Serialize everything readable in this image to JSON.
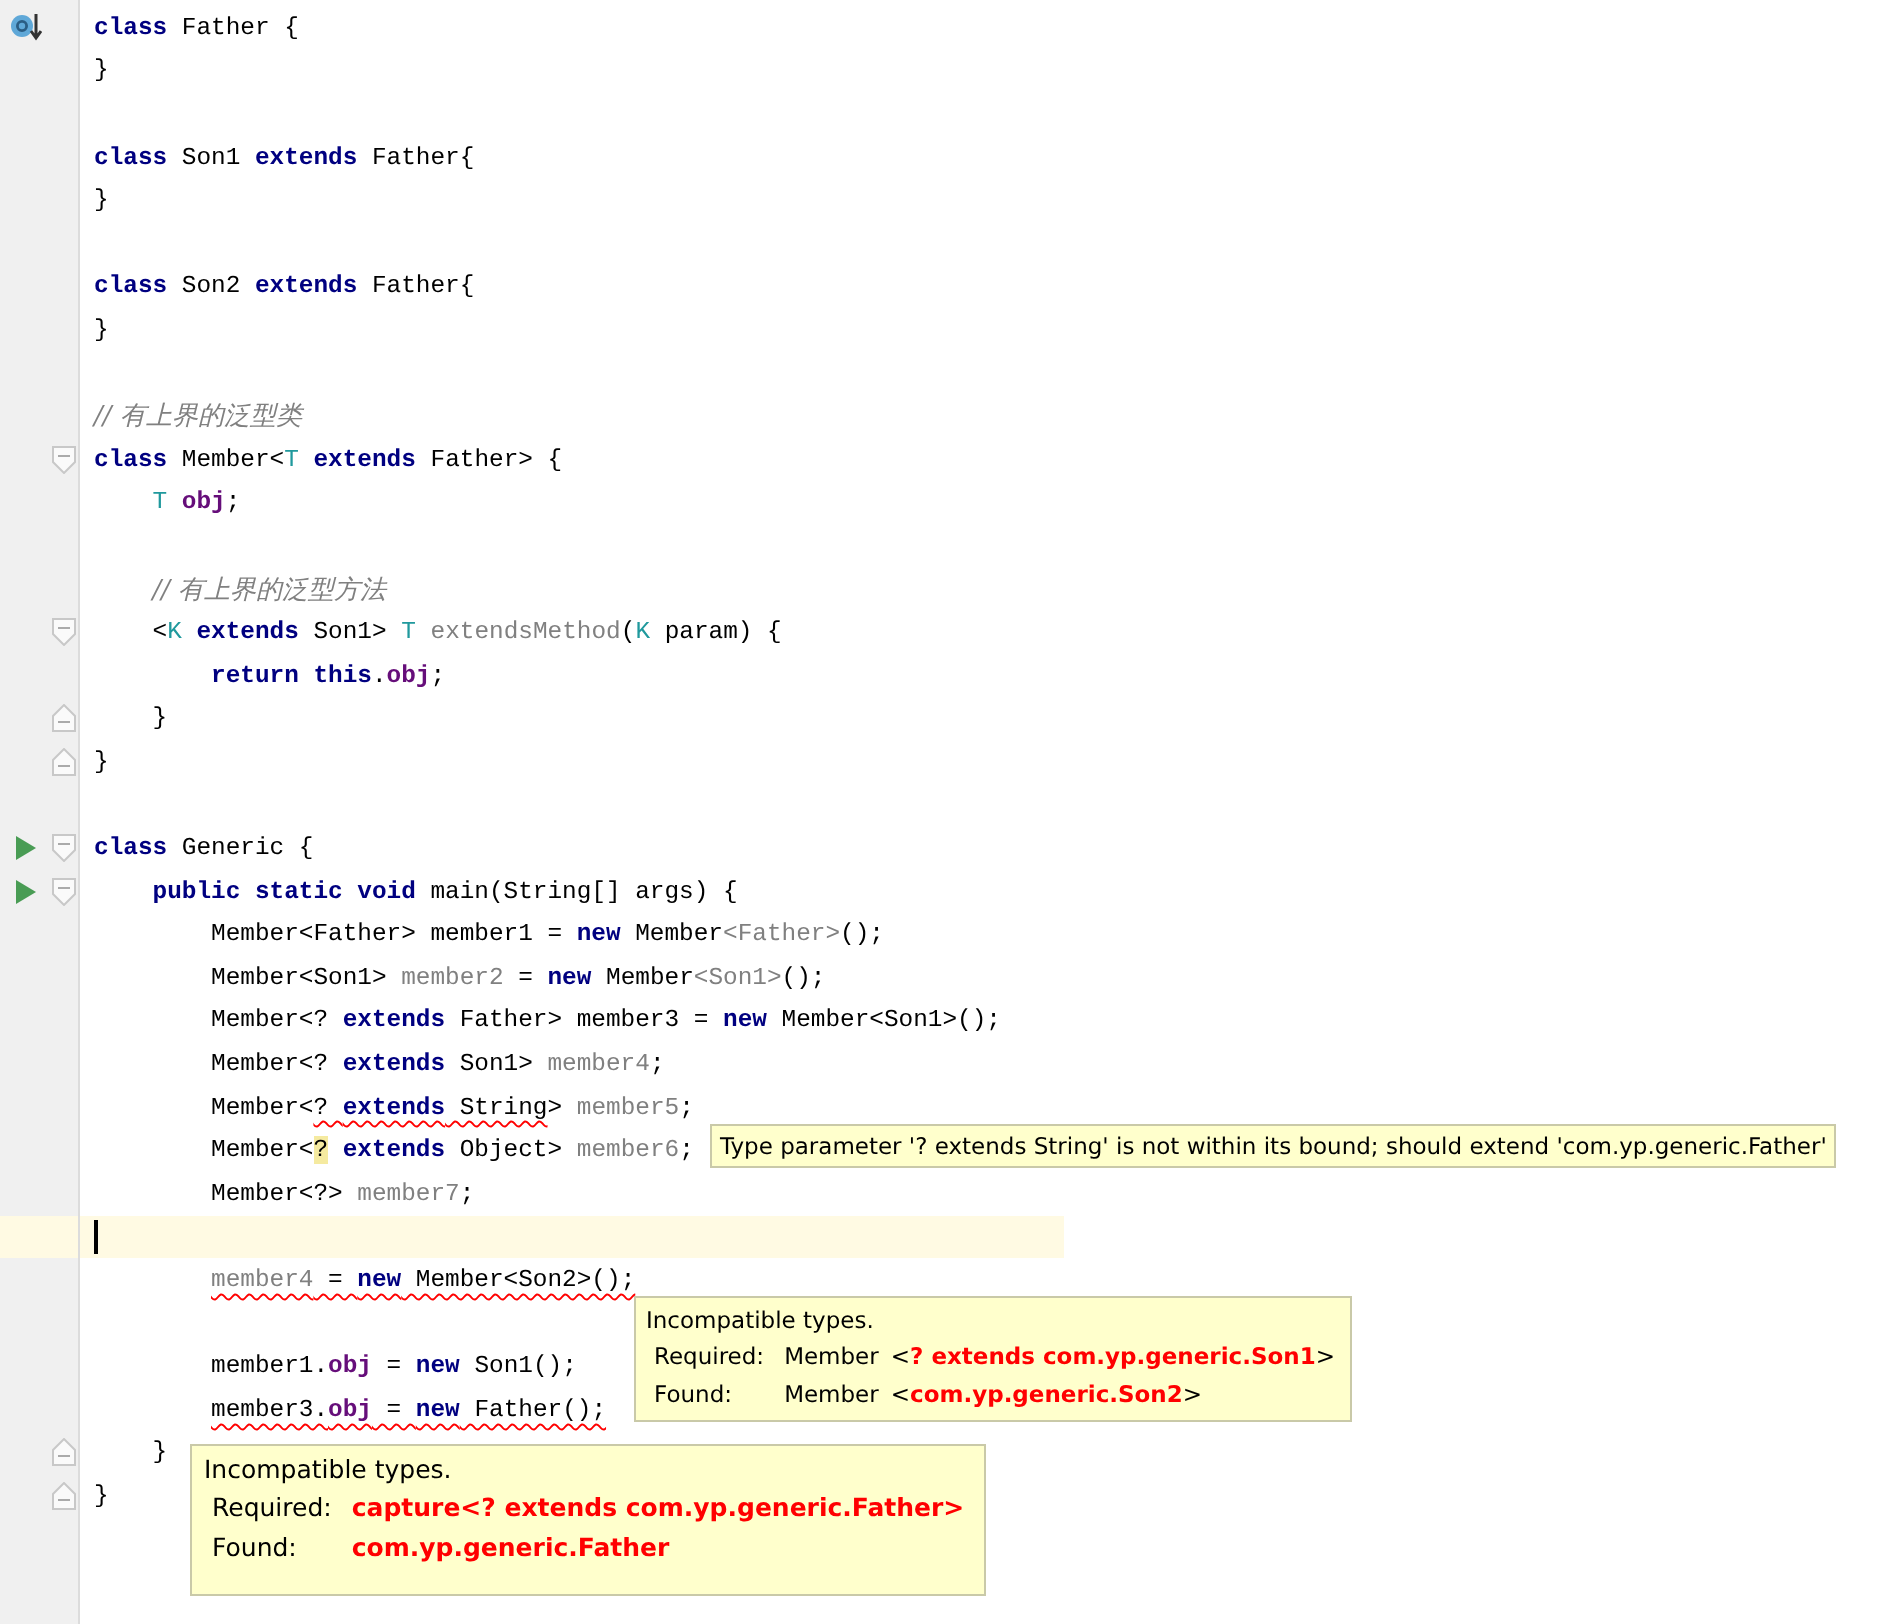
{
  "editor": {
    "lines": [
      {
        "override_marker": true,
        "tokens": [
          {
            "text": "class",
            "kind": "k"
          },
          {
            "text": " Father {",
            "kind": "p"
          }
        ]
      },
      {
        "tokens": [
          {
            "text": "}",
            "kind": "p"
          }
        ]
      },
      {
        "kind": "blank"
      },
      {
        "tokens": [
          {
            "text": "class",
            "kind": "k"
          },
          {
            "text": " Son1 ",
            "kind": "p"
          },
          {
            "text": "extends",
            "kind": "k"
          },
          {
            "text": " Father{",
            "kind": "p"
          }
        ]
      },
      {
        "tokens": [
          {
            "text": "}",
            "kind": "p"
          }
        ]
      },
      {
        "kind": "blank"
      },
      {
        "tokens": [
          {
            "text": "class",
            "kind": "k"
          },
          {
            "text": " Son2 ",
            "kind": "p"
          },
          {
            "text": "extends",
            "kind": "k"
          },
          {
            "text": " Father{",
            "kind": "p"
          }
        ]
      },
      {
        "tokens": [
          {
            "text": "}",
            "kind": "p"
          }
        ]
      },
      {
        "kind": "blank"
      },
      {
        "tokens": [
          {
            "text": "// 有上界的泛型类",
            "kind": "c"
          }
        ]
      },
      {
        "fold_start": true,
        "tokens": [
          {
            "text": "class",
            "kind": "k"
          },
          {
            "text": " Member<",
            "kind": "p"
          },
          {
            "text": "T",
            "kind": "t"
          },
          {
            "text": " extends",
            "kind": "k"
          },
          {
            "text": " Father> {",
            "kind": "p"
          }
        ],
        "children": [
          {
            "tokens": [
              {
                "text": "T",
                "kind": "t"
              },
              {
                "text": " obj",
                "kind": "f"
              },
              {
                "text": ";",
                "kind": "p"
              }
            ]
          },
          {
            "kind": "blank"
          },
          {
            "tokens": [
              {
                "text": "// 有上界的泛型方法",
                "kind": "c"
              }
            ]
          },
          {
            "fold_start": true,
            "tokens": [
              {
                "text": "<",
                "kind": "p"
              },
              {
                "text": "K",
                "kind": "t"
              },
              {
                "text": " extends",
                "kind": "k"
              },
              {
                "text": " Son1> ",
                "kind": "p"
              },
              {
                "text": "T",
                "kind": "t"
              },
              {
                "text": " extendsMethod",
                "kind": "u"
              },
              {
                "text": "(",
                "kind": "p"
              },
              {
                "text": "K",
                "kind": "t"
              },
              {
                "text": " param) {",
                "kind": "p"
              }
            ],
            "children": [
              {
                "tokens": [
                  {
                    "text": "return",
                    "kind": "k"
                  },
                  {
                    "text": " this",
                    "kind": "k"
                  },
                  {
                    "text": ".",
                    "kind": "p"
                  },
                  {
                    "text": "obj",
                    "kind": "f"
                  },
                  {
                    "text": ";",
                    "kind": "p"
                  }
                ]
              }
            ]
          },
          {
            "fold_end": true,
            "tokens": [
              {
                "text": "}",
                "kind": "p"
              }
            ]
          }
        ]
      },
      {
        "fold_end": true,
        "tokens": [
          {
            "text": "}",
            "kind": "p"
          }
        ]
      },
      {
        "kind": "blank"
      },
      {
        "run_marker": true,
        "fold_start": true,
        "tokens": [
          {
            "text": "class",
            "kind": "k"
          },
          {
            "text": " Generic {",
            "kind": "p"
          }
        ],
        "children": [
          {
            "run_marker": true,
            "fold_start": true,
            "tokens": [
              {
                "text": "public static void",
                "kind": "k"
              },
              {
                "text": " main(String[] args) {",
                "kind": "p"
              }
            ],
            "children": [
              {
                "tokens": [
                  {
                    "text": "Member<Father> member1 = ",
                    "kind": "p"
                  },
                  {
                    "text": "new",
                    "kind": "k"
                  },
                  {
                    "text": " Member",
                    "kind": "p"
                  },
                  {
                    "text": "<Father>",
                    "kind": "u"
                  },
                  {
                    "text": "();",
                    "kind": "p"
                  }
                ]
              },
              {
                "tokens": [
                  {
                    "text": "Member<Son1> ",
                    "kind": "p"
                  },
                  {
                    "text": "member2",
                    "kind": "u"
                  },
                  {
                    "text": " = ",
                    "kind": "p"
                  },
                  {
                    "text": "new",
                    "kind": "k"
                  },
                  {
                    "text": " Member",
                    "kind": "p"
                  },
                  {
                    "text": "<Son1>",
                    "kind": "u"
                  },
                  {
                    "text": "();",
                    "kind": "p"
                  }
                ]
              },
              {
                "tokens": [
                  {
                    "text": "Member<? ",
                    "kind": "p"
                  },
                  {
                    "text": "extends",
                    "kind": "k"
                  },
                  {
                    "text": " Father> member3 = ",
                    "kind": "p"
                  },
                  {
                    "text": "new",
                    "kind": "k"
                  },
                  {
                    "text": " Member<Son1>();",
                    "kind": "p"
                  }
                ]
              },
              {
                "tokens": [
                  {
                    "text": "Member<? ",
                    "kind": "p"
                  },
                  {
                    "text": "extends",
                    "kind": "k"
                  },
                  {
                    "text": " Son1> ",
                    "kind": "p"
                  },
                  {
                    "text": "member4",
                    "kind": "u"
                  },
                  {
                    "text": ";",
                    "kind": "p"
                  }
                ]
              },
              {
                "tokens": [
                  {
                    "text": "Member<",
                    "kind": "p"
                  },
                  {
                    "text": "? ",
                    "kind": "p",
                    "error": true
                  },
                  {
                    "text": "extends",
                    "kind": "k",
                    "error": true
                  },
                  {
                    "text": " String",
                    "kind": "p",
                    "error": true
                  },
                  {
                    "text": "> ",
                    "kind": "p"
                  },
                  {
                    "text": "member5",
                    "kind": "u"
                  },
                  {
                    "text": ";",
                    "kind": "p"
                  }
                ]
              },
              {
                "tokens": [
                  {
                    "text": "Member<",
                    "kind": "p"
                  },
                  {
                    "text": "?",
                    "kind": "p",
                    "highlight": true
                  },
                  {
                    "text": " extends",
                    "kind": "k"
                  },
                  {
                    "text": " Object> ",
                    "kind": "p"
                  },
                  {
                    "text": "member6",
                    "kind": "u"
                  },
                  {
                    "text": ";",
                    "kind": "p"
                  }
                ]
              },
              {
                "tokens": [
                  {
                    "text": "Member<?> ",
                    "kind": "p"
                  },
                  {
                    "text": "member7",
                    "kind": "u"
                  },
                  {
                    "text": ";",
                    "kind": "p"
                  }
                ]
              },
              {
                "kind": "blank",
                "current": true
              },
              {
                "tokens": [
                  {
                    "text": "member4",
                    "kind": "u",
                    "error": true
                  },
                  {
                    "text": " = ",
                    "kind": "p",
                    "error": true
                  },
                  {
                    "text": "new",
                    "kind": "k",
                    "error": true
                  },
                  {
                    "text": " Member<Son2>();",
                    "kind": "p",
                    "error": true
                  }
                ]
              },
              {
                "kind": "blank"
              },
              {
                "tokens": [
                  {
                    "text": "member1.",
                    "kind": "p"
                  },
                  {
                    "text": "obj",
                    "kind": "f"
                  },
                  {
                    "text": " = ",
                    "kind": "p"
                  },
                  {
                    "text": "new",
                    "kind": "k"
                  },
                  {
                    "text": " Son1();",
                    "kind": "p"
                  }
                ]
              },
              {
                "tokens": [
                  {
                    "text": "member3.",
                    "kind": "p",
                    "error": true
                  },
                  {
                    "text": "obj",
                    "kind": "f",
                    "error": true
                  },
                  {
                    "text": " = ",
                    "kind": "p",
                    "error": true
                  },
                  {
                    "text": "new",
                    "kind": "k",
                    "error": true
                  },
                  {
                    "text": " Father();",
                    "kind": "p",
                    "error": true
                  }
                ]
              }
            ]
          },
          {
            "fold_end": true,
            "tokens": [
              {
                "text": "}",
                "kind": "p"
              }
            ]
          }
        ]
      },
      {
        "fold_end": true,
        "tokens": [
          {
            "text": "}",
            "kind": "p"
          }
        ]
      }
    ]
  },
  "tooltips": [
    {
      "kind": "single",
      "text": "Type parameter '? extends String' is not within its bound; should extend 'com.yp.generic.Father'"
    },
    {
      "kind": "details",
      "title": "Incompatible types.",
      "rows": [
        {
          "label": "Required:",
          "type_name": "Member",
          "value": [
            {
              "text": "<",
              "error": false
            },
            {
              "text": "? extends com.yp.generic.Son1",
              "error": true
            },
            {
              "text": ">",
              "error": false
            }
          ]
        },
        {
          "label": "Found:",
          "type_name": "Member",
          "value": [
            {
              "text": "<",
              "error": false
            },
            {
              "text": "com.yp.generic.Son2",
              "error": true
            },
            {
              "text": ">",
              "error": false
            }
          ]
        }
      ]
    },
    {
      "kind": "details",
      "title": "Incompatible types.",
      "rows": [
        {
          "label": "Required:",
          "value": [
            {
              "text": "capture<? extends com.yp.generic.Father>",
              "error": true
            }
          ]
        },
        {
          "label": "Found:",
          "value": [
            {
              "text": "com.yp.generic.Father",
              "error": true
            }
          ]
        }
      ]
    }
  ]
}
